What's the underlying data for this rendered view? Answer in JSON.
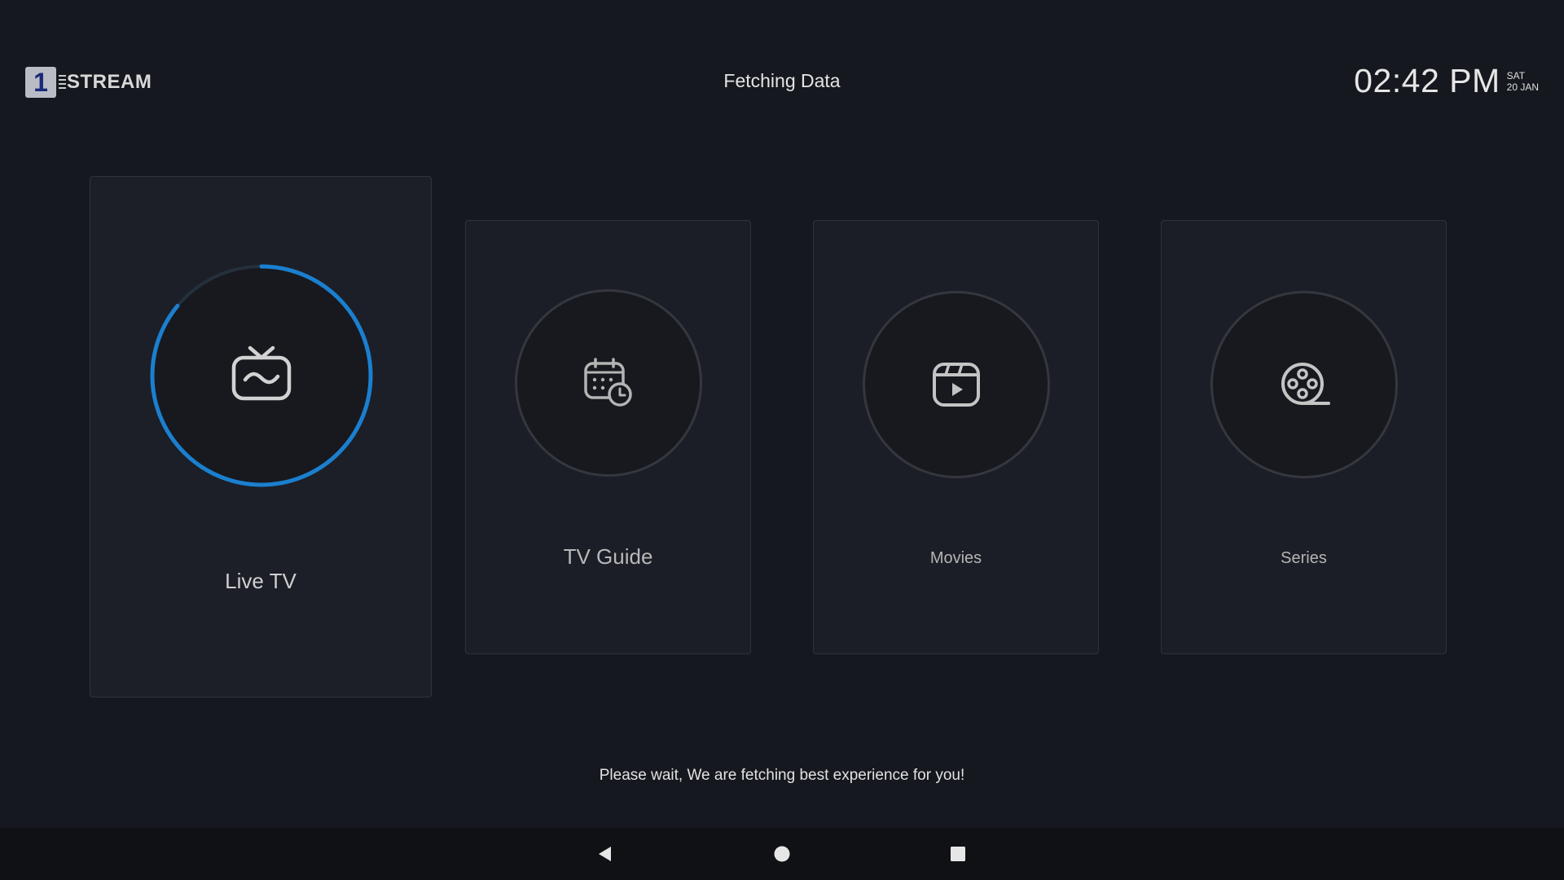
{
  "header": {
    "logo_number": "1",
    "logo_text": "STREAM",
    "title": "Fetching Data",
    "time": "02:42 PM",
    "day": "SAT",
    "date": "20 JAN"
  },
  "tiles": [
    {
      "label": "Live TV",
      "icon": "tv-icon",
      "focused": true,
      "loading_progress": 0.86
    },
    {
      "label": "TV Guide",
      "icon": "calendar-clock-icon",
      "focused": false
    },
    {
      "label": "Movies",
      "icon": "video-play-icon",
      "focused": false
    },
    {
      "label": "Series",
      "icon": "film-reel-icon",
      "focused": false
    }
  ],
  "footer": {
    "message": "Please wait, We are fetching best experience for you!"
  },
  "navbar": {
    "buttons": [
      "back-icon",
      "home-icon",
      "recents-icon"
    ]
  },
  "colors": {
    "background": "#15181e",
    "tile": "#1b1e26",
    "accent": "#1b7fcf"
  }
}
